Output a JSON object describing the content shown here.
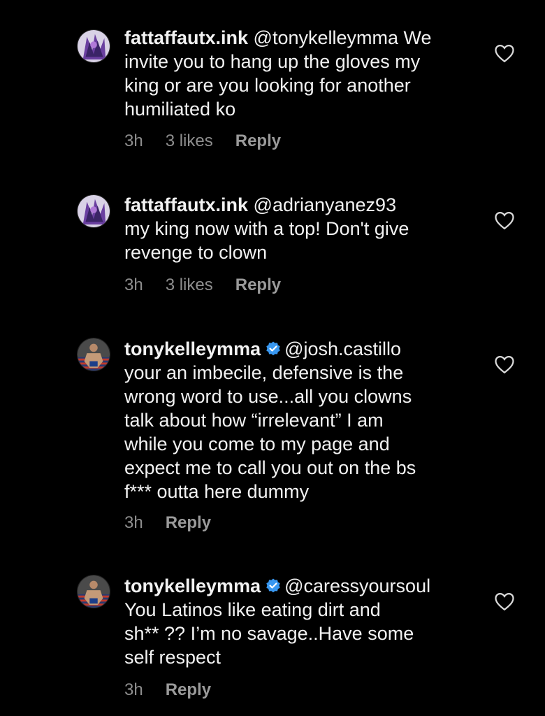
{
  "colors": {
    "background": "#000000",
    "text": "#f2f2f2",
    "meta": "#8e8e8e",
    "verified": "#3897f0"
  },
  "comments": [
    {
      "username": "fattaffautx.ink",
      "verified": false,
      "avatar_icon": "tattoo-art-avatar",
      "lines": [
        "@tonykelleymma We",
        "invite you to hang up the gloves my",
        "king or are you looking for another",
        "humiliated ko"
      ],
      "time": "3h",
      "likes": "3 likes",
      "reply": "Reply",
      "like_icon": "heart-outline-icon"
    },
    {
      "username": "fattaffautx.ink",
      "verified": false,
      "avatar_icon": "tattoo-art-avatar",
      "lines": [
        "@adrianyanez93",
        "my king now with a top! Don't give",
        "revenge to clown"
      ],
      "time": "3h",
      "likes": "3 likes",
      "reply": "Reply",
      "like_icon": "heart-outline-icon"
    },
    {
      "username": "tonykelleymma",
      "verified": true,
      "avatar_icon": "fighter-avatar",
      "lines": [
        "@josh.castillo",
        "your an imbecile, defensive is the",
        "wrong word to use...all you clowns",
        "talk about how “irrelevant” I am",
        "while you come to my page and",
        "expect me to call you out on the bs",
        "f*** outta here dummy"
      ],
      "time": "3h",
      "reply": "Reply",
      "like_icon": "heart-outline-icon"
    },
    {
      "username": "tonykelleymma",
      "verified": true,
      "avatar_icon": "fighter-avatar",
      "lines": [
        "@caressyoursoul",
        "You Latinos like eating dirt and",
        "sh** ?? I’m no savage..Have some",
        "self respect"
      ],
      "time": "3h",
      "reply": "Reply",
      "like_icon": "heart-outline-icon"
    }
  ]
}
